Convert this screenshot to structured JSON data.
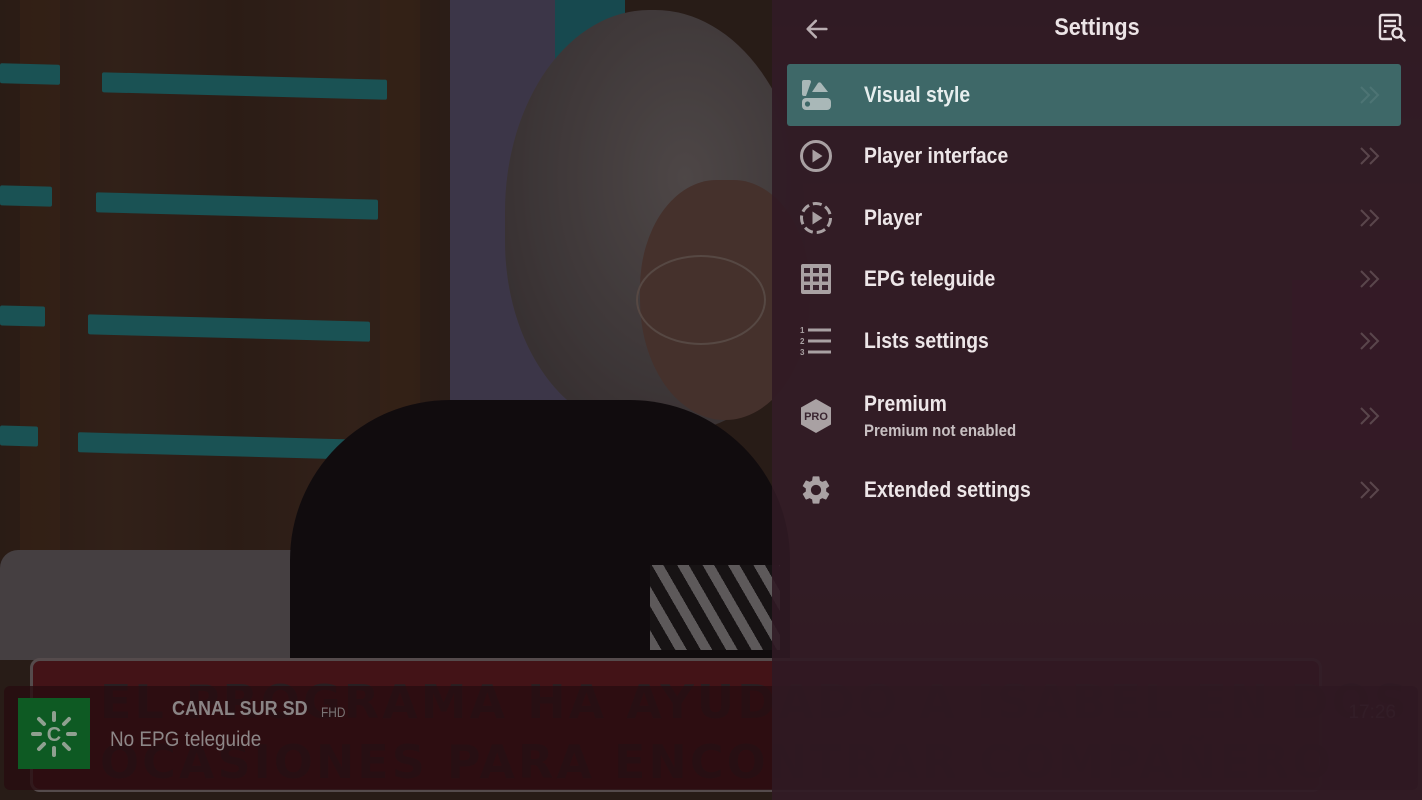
{
  "settings": {
    "title": "Settings",
    "back_icon": "arrow-left-icon",
    "search_icon": "document-search-icon",
    "items": [
      {
        "label": "Visual style",
        "icon": "palette-swatch-icon",
        "active": true
      },
      {
        "label": "Player interface",
        "icon": "play-circle-icon",
        "active": false
      },
      {
        "label": "Player",
        "icon": "play-circle-dashed-icon",
        "active": false
      },
      {
        "label": "EPG teleguide",
        "icon": "grid-icon",
        "active": false
      },
      {
        "label": "Lists settings",
        "icon": "numbered-list-icon",
        "active": false
      },
      {
        "label": "Premium",
        "sublabel": "Premium not enabled",
        "icon": "pro-badge-icon",
        "active": false
      },
      {
        "label": "Extended settings",
        "icon": "gear-icon",
        "active": false
      }
    ],
    "chevron_icon": "double-chevron-right-icon",
    "pro_badge_text": "PRO"
  },
  "channel_bar": {
    "channel_name": "CANAL SUR SD",
    "quality": "FHD",
    "epg_status": "No EPG teleguide",
    "time": "17:26",
    "logo_letter": "C"
  },
  "video": {
    "ticker_line1": "EL PROGRAMA HA AYUDADO A ISABEL EN DOS",
    "ticker_line2": "OCASIONES PARA ENCONTRAR COMPAÑERO"
  },
  "colors": {
    "active_item": "#3e6868",
    "panel_bg": "#301a24",
    "channel_logo_bg": "#0e5a23"
  }
}
